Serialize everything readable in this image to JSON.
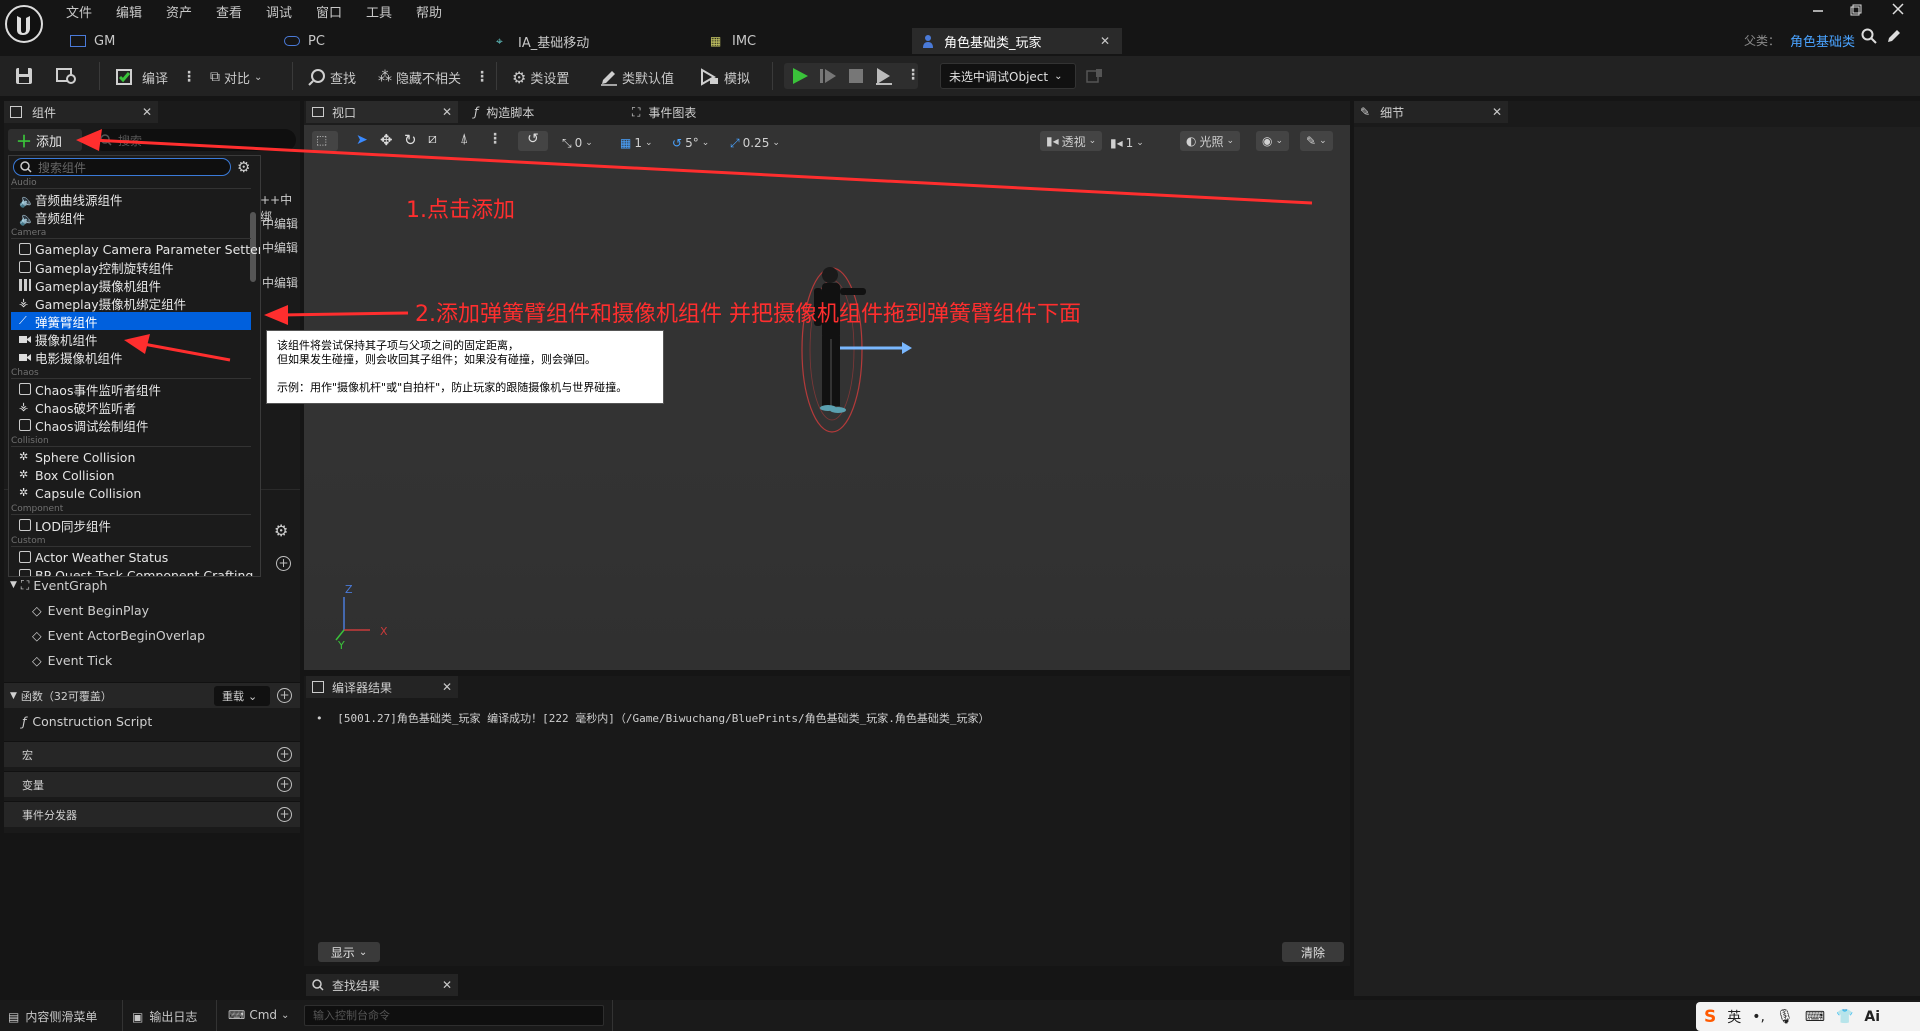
{
  "menu": [
    "文件",
    "编辑",
    "资产",
    "查看",
    "调试",
    "窗口",
    "工具",
    "帮助"
  ],
  "doc_tabs": [
    {
      "label": "GM"
    },
    {
      "label": "PC"
    },
    {
      "label": "IA_基础移动"
    },
    {
      "label": "IMC"
    },
    {
      "label": "角色基础类_玩家"
    }
  ],
  "parent_class": {
    "label": "父类：",
    "value": "角色基础类"
  },
  "toolbar": {
    "compile": "编译",
    "diff": "对比",
    "find": "查找",
    "hide_unrelated": "隐藏不相关",
    "class_settings": "类设置",
    "class_defaults": "类默认值",
    "simulate": "模拟",
    "debug_object": "未选中调试Object"
  },
  "components": {
    "tab": "组件",
    "add": "添加",
    "search_placeholder": "搜索",
    "dropdown_search_placeholder": "搜索组件",
    "categories": [
      {
        "label": "Audio"
      },
      {
        "label": "Camera"
      },
      {
        "label": "Chaos"
      },
      {
        "label": "Collision"
      },
      {
        "label": "Component"
      },
      {
        "label": "Custom"
      }
    ],
    "items": [
      {
        "label": "音频曲线源组件",
        "icon": "speaker-icon"
      },
      {
        "label": "音频组件",
        "icon": "speaker-icon"
      },
      {
        "label": "Gameplay Camera Parameter Setter",
        "icon": "component-icon"
      },
      {
        "label": "Gameplay控制旋转组件",
        "icon": "component-icon"
      },
      {
        "label": "Gameplay摄像机组件",
        "icon": "camera-rig-icon"
      },
      {
        "label": "Gameplay摄像机绑定组件",
        "icon": "rig-icon"
      },
      {
        "label": "弹簧臂组件",
        "icon": "spring-arm-icon"
      },
      {
        "label": "摄像机组件",
        "icon": "camera-icon"
      },
      {
        "label": "电影摄像机组件",
        "icon": "camera-icon"
      },
      {
        "label": "Chaos事件监听者组件",
        "icon": "component-icon"
      },
      {
        "label": "Chaos破坏监听者",
        "icon": "rig-icon"
      },
      {
        "label": "Chaos调试绘制组件",
        "icon": "component-icon"
      },
      {
        "label": "Sphere Collision",
        "icon": "collision-icon"
      },
      {
        "label": "Box Collision",
        "icon": "collision-icon"
      },
      {
        "label": "Capsule Collision",
        "icon": "collision-icon"
      },
      {
        "label": "LOD同步组件",
        "icon": "component-icon"
      },
      {
        "label": "Actor Weather Status",
        "icon": "component-icon"
      },
      {
        "label": "BP Quest Task Component Crafting",
        "icon": "component-icon"
      }
    ],
    "behind_labels": [
      "++中绑",
      "中编辑",
      "中编辑",
      "中编辑"
    ]
  },
  "tooltip": {
    "line1": "该组件将尝试保持其子项与父项之间的固定距离，",
    "line2": "但如果发生碰撞，则会收回其子组件；如果没有碰撞，则会弹回。",
    "line3": "示例：用作\"摄像机杆\"或\"自拍杆\"，防止玩家的跟随摄像机与世界碰撞。"
  },
  "my_blueprint": {
    "event_graph": "EventGraph",
    "events": [
      "Event BeginPlay",
      "Event ActorBeginOverlap",
      "Event Tick"
    ],
    "functions_header": "函数（32可覆盖）",
    "override": "重载",
    "construction_script": "Construction Script",
    "macros": "宏",
    "variables": "变量",
    "dispatchers": "事件分发器"
  },
  "viewport_tabs": [
    {
      "label": "视口"
    },
    {
      "label": "构造脚本"
    },
    {
      "label": "事件图表"
    }
  ],
  "viewport_toolbar": {
    "translate_snap": "0",
    "grid_snap": "1",
    "rotate_snap": "5°",
    "scale_snap": "0.25",
    "perspective": "透视",
    "speed": "1",
    "lighting": "光照"
  },
  "axes": {
    "z": "Z",
    "x": "X",
    "y": "Y"
  },
  "annotations": {
    "step1": "1.点击添加",
    "step2": "2.添加弹簧臂组件和摄像机组件 并把摄像机组件拖到弹簧臂组件下面"
  },
  "compiler": {
    "tab": "编译器结果",
    "message": "[5001.27]角色基础类_玩家 编译成功！[222 毫秒内]（/Game/Biwuchang/BluePrints/角色基础类_玩家.角色基础类_玩家）",
    "show": "显示",
    "clear": "清除"
  },
  "find_results": {
    "tab": "查找结果"
  },
  "details": {
    "tab": "细节"
  },
  "statusbar": {
    "content_drawer": "内容侧滑菜单",
    "output_log": "输出日志",
    "cmd": "Cmd",
    "console_placeholder": "输入控制台命令"
  },
  "ime": {
    "lang": "英",
    "ai": "Ai"
  },
  "colors": {
    "accent": "#0060dd",
    "annotation": "#ff2e2e",
    "play": "#3ac23a",
    "link": "#4aa3ff"
  }
}
